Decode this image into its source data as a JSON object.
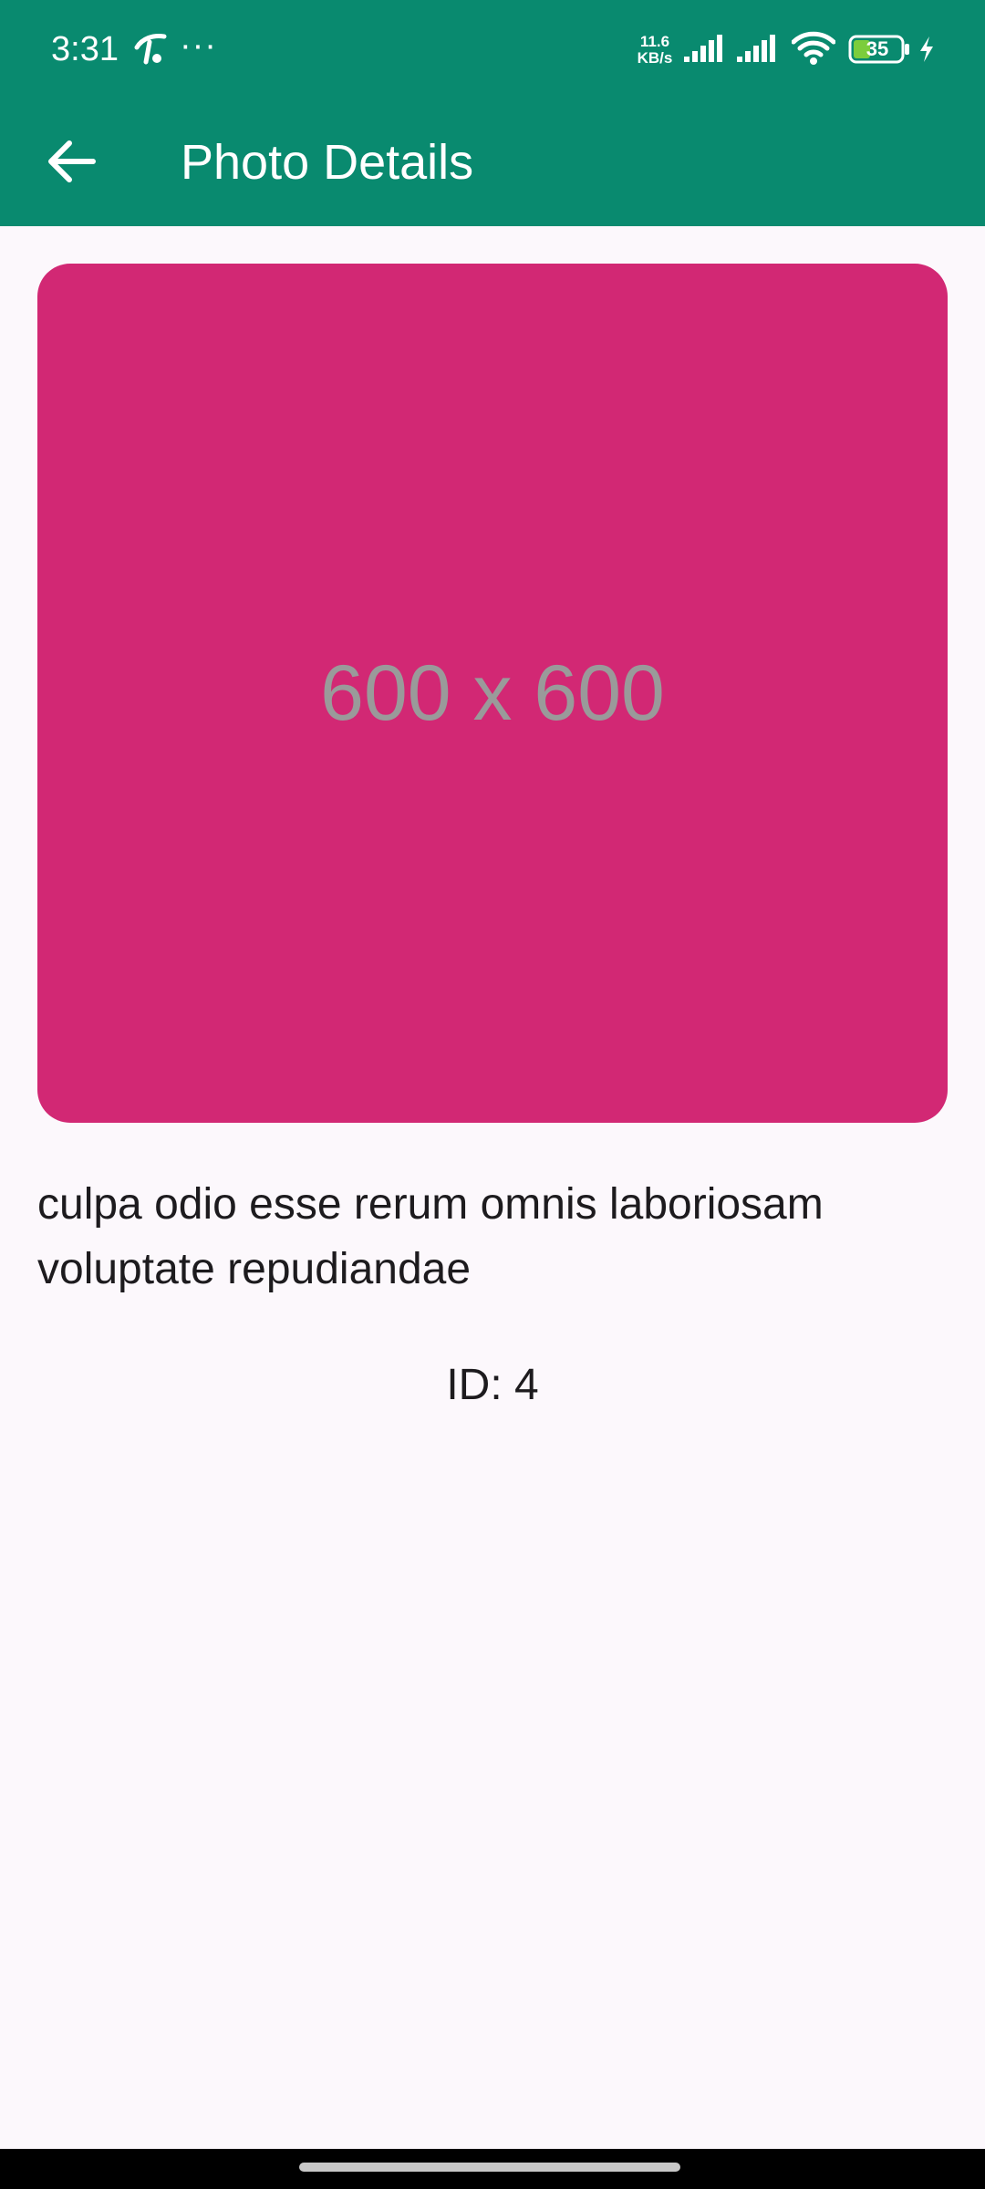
{
  "status_bar": {
    "time": "3:31",
    "more_indicator": "···",
    "net_speed_value": "11.6",
    "net_speed_unit": "KB/s",
    "battery_level": "35",
    "icons": [
      "carrier-icon",
      "signal-icon",
      "signal-icon",
      "wifi-icon",
      "battery-icon",
      "charging-icon"
    ]
  },
  "app_bar": {
    "back_icon": "arrow-back-icon",
    "title": "Photo Details"
  },
  "photo": {
    "placeholder_label": "600 x 600",
    "background_color": "#d22874",
    "title": "culpa odio esse rerum omnis laboriosam voluptate repudiandae",
    "id_text": "ID: 4"
  },
  "colors": {
    "primary": "#098a6f",
    "background": "#fcf8fc",
    "text": "#1d1b1e"
  }
}
